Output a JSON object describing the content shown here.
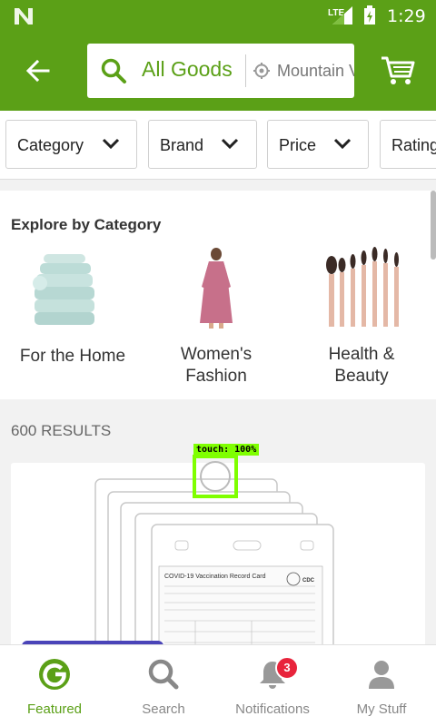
{
  "status_bar": {
    "network": "LTE",
    "time": "1:29"
  },
  "header": {
    "search_query": "All Goods",
    "location": "Mountain View"
  },
  "filters": [
    {
      "label": "Category"
    },
    {
      "label": "Brand"
    },
    {
      "label": "Price"
    },
    {
      "label": "Rating"
    }
  ],
  "categories": {
    "title": "Explore by Category",
    "items": [
      {
        "label": "For the Home"
      },
      {
        "label": "Women's Fashion"
      },
      {
        "label": "Health & Beauty"
      }
    ]
  },
  "results": {
    "count_label": "600 RESULTS"
  },
  "product": {
    "card_title": "COVID-19 Vaccination Record Card",
    "logo_text": "CDC"
  },
  "touch": {
    "label": "touch: 100%"
  },
  "bottom_nav": {
    "items": [
      {
        "label": "Featured",
        "icon": "featured-g-icon",
        "active": true
      },
      {
        "label": "Search",
        "icon": "search-icon"
      },
      {
        "label": "Notifications",
        "icon": "bell-icon",
        "badge": "3"
      },
      {
        "label": "My Stuff",
        "icon": "person-icon"
      }
    ]
  },
  "colors": {
    "brand_green": "#5ba017",
    "badge_red": "#e8243c",
    "touch_highlight": "#7fff00"
  }
}
